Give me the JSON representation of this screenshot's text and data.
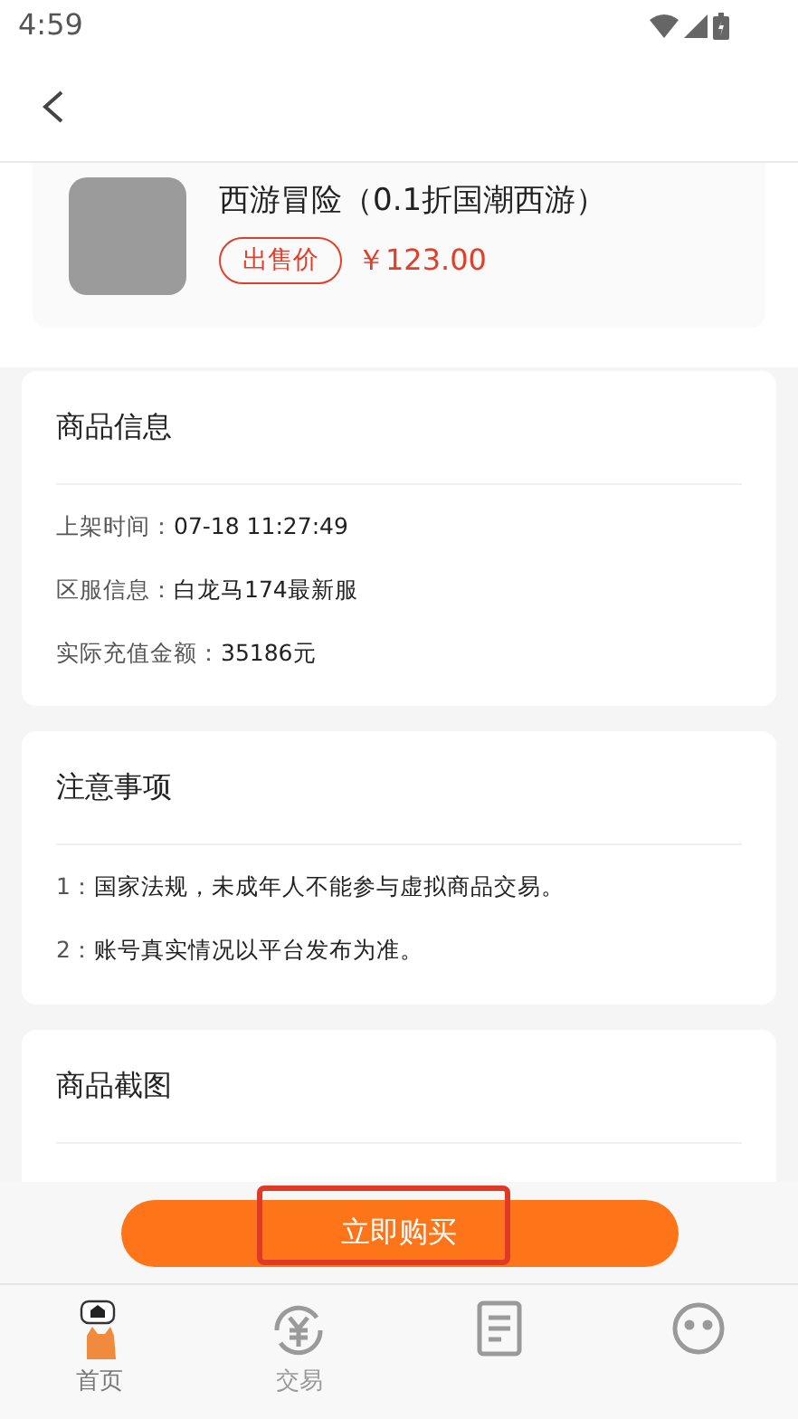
{
  "status_bar": {
    "time": "4:59"
  },
  "product": {
    "title": "西游冒险（0.1折国潮西游）",
    "price_tag": "出售价",
    "price": "￥123.00"
  },
  "sections": [
    {
      "title": "商品信息",
      "lines": [
        {
          "label": "上架时间：",
          "value": "07-18 11:27:49"
        },
        {
          "label": "区服信息：",
          "value": "白龙马174最新服"
        },
        {
          "label": "实际充值金额：",
          "value": "35186元"
        }
      ]
    },
    {
      "title": "注意事项",
      "lines": [
        {
          "label": "1：",
          "value": "国家法规，未成年人不能参与虚拟商品交易。"
        },
        {
          "label": "2：",
          "value": "账号真实情况以平台发布为准。"
        }
      ]
    },
    {
      "title": "商品截图"
    }
  ],
  "buy_button": {
    "label": "立即购买",
    "highlighted": true
  },
  "tab_bar": [
    {
      "kind": "home",
      "label": "首页",
      "selected": true
    },
    {
      "kind": "trade",
      "label": "交易",
      "selected": false
    },
    {
      "kind": "doc",
      "selected": false
    },
    {
      "kind": "face",
      "selected": false
    }
  ]
}
